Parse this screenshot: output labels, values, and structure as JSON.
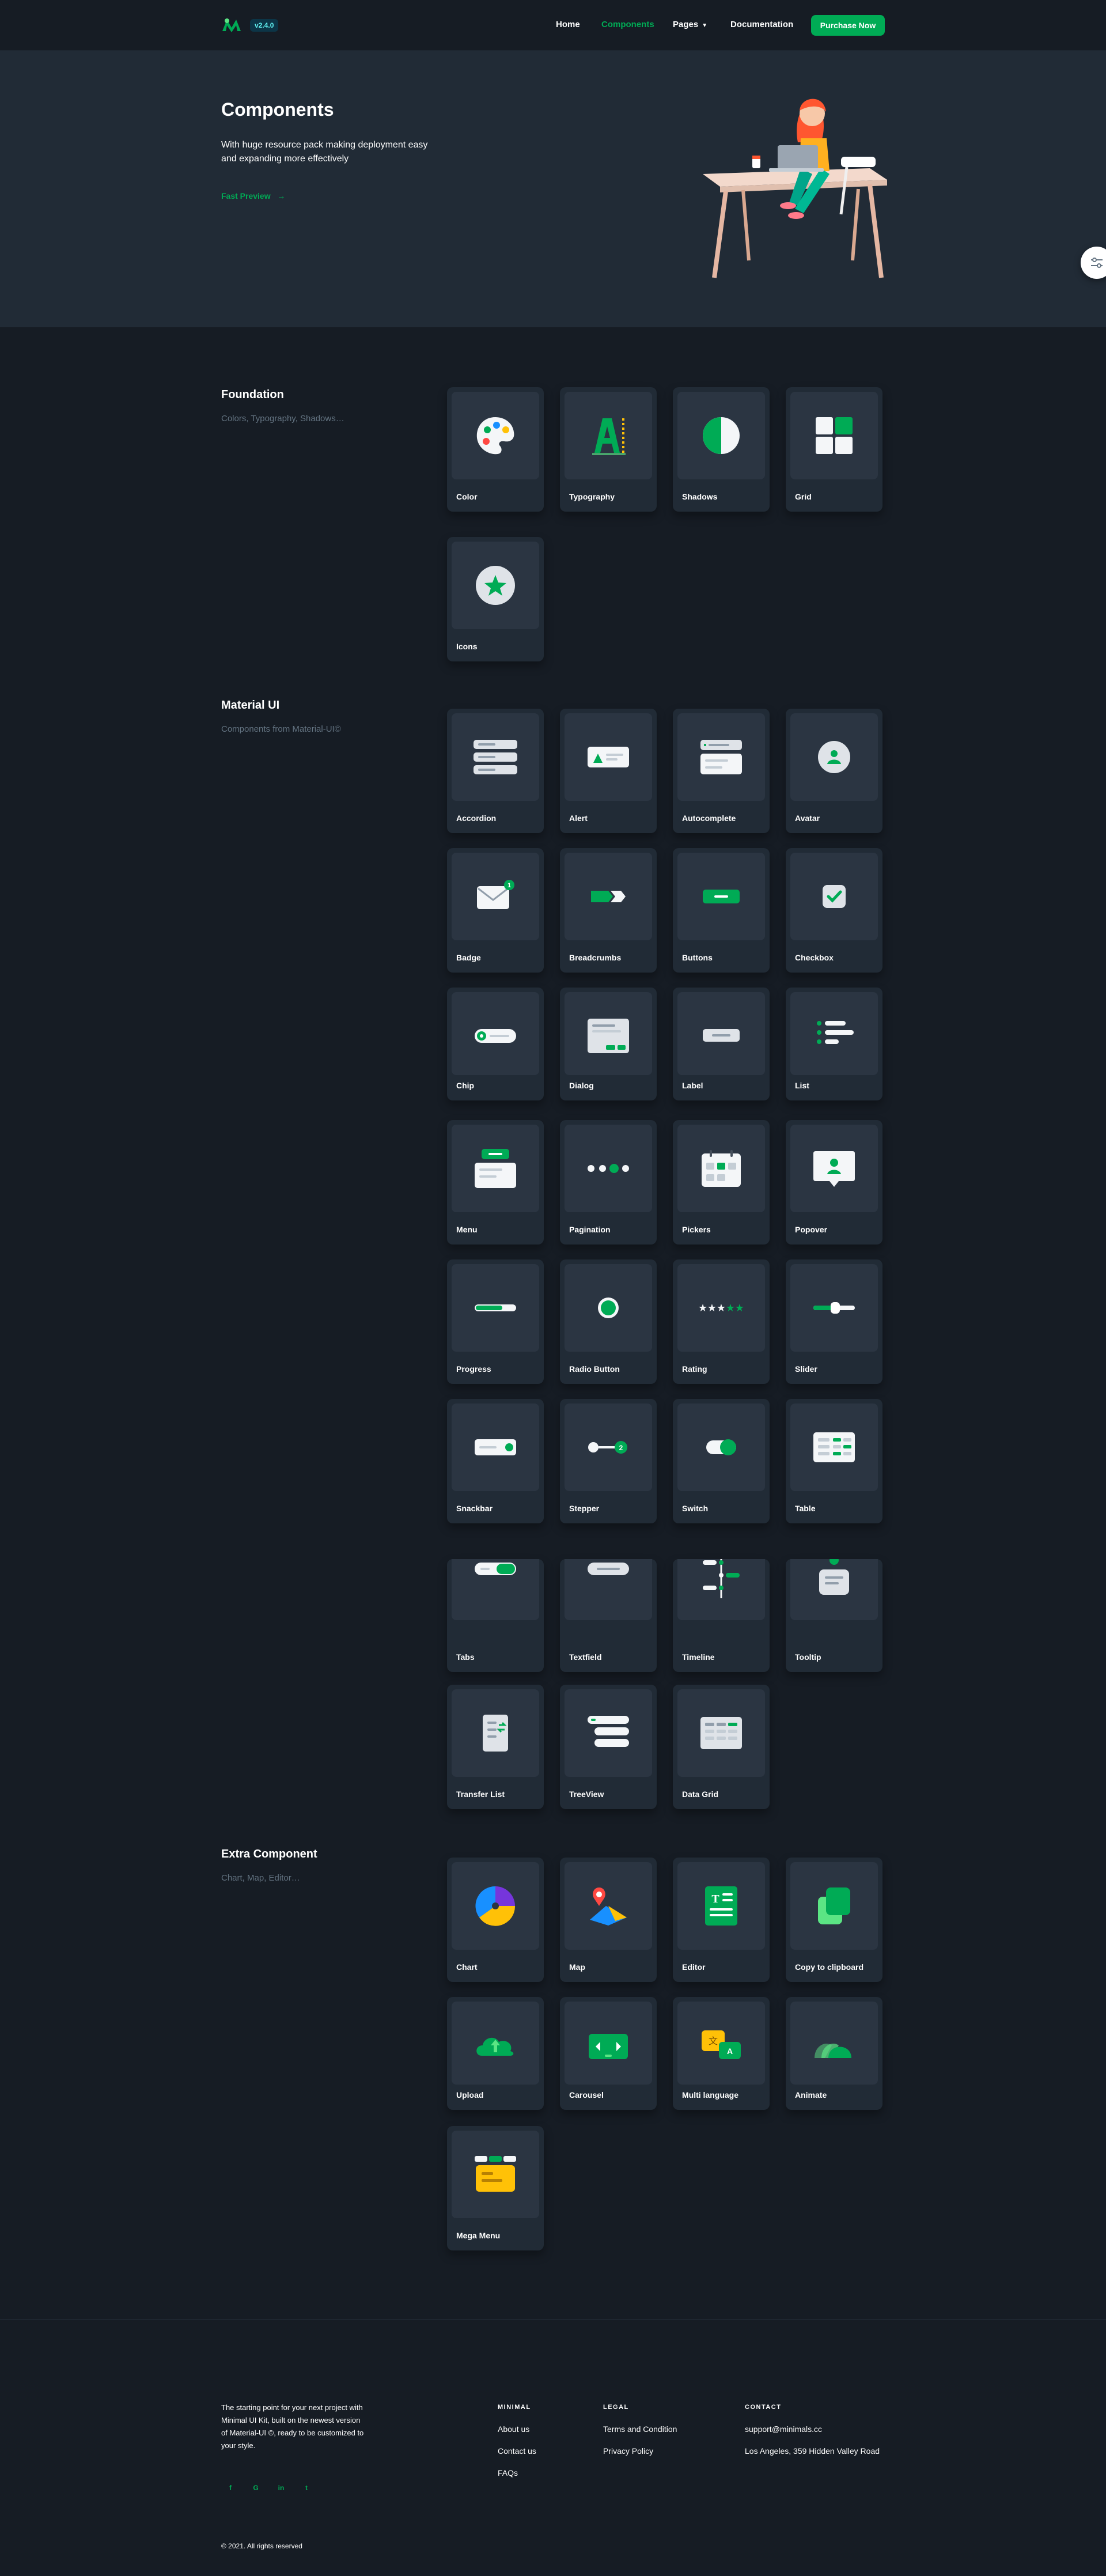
{
  "header": {
    "version": "v2.4.0",
    "nav": {
      "home": "Home",
      "components": "Components",
      "pages": "Pages",
      "documentation": "Documentation"
    },
    "purchase_label": "Purchase Now"
  },
  "hero": {
    "title": "Components",
    "description": "With huge resource pack making deployment easy and expanding more effectively",
    "preview_link": "Fast Preview"
  },
  "sections": {
    "foundation": {
      "title": "Foundation",
      "subtitle": "Colors, Typography, Shadows…",
      "items": [
        "Color",
        "Typography",
        "Shadows",
        "Grid",
        "Icons"
      ]
    },
    "material": {
      "title": "Material UI",
      "subtitle": "Components from Material-UI©",
      "items": [
        "Accordion",
        "Alert",
        "Autocomplete",
        "Avatar",
        "Badge",
        "Breadcrumbs",
        "Buttons",
        "Checkbox",
        "Chip",
        "Dialog",
        "Label",
        "List",
        "Menu",
        "Pagination",
        "Pickers",
        "Popover",
        "Progress",
        "Radio Button",
        "Rating",
        "Slider",
        "Snackbar",
        "Stepper",
        "Switch",
        "Table",
        "Tabs",
        "Textfield",
        "Timeline",
        "Tooltip",
        "Transfer List",
        "TreeView",
        "Data Grid"
      ]
    },
    "extra": {
      "title": "Extra Component",
      "subtitle": "Chart, Map, Editor…",
      "items": [
        "Chart",
        "Map",
        "Editor",
        "Copy to clipboard",
        "Upload",
        "Carousel",
        "Multi language",
        "Animate",
        "Mega Menu"
      ]
    }
  },
  "footer": {
    "description": "The starting point for your next project with Minimal UI Kit, built on the newest version of Material-UI ©, ready to be customized to your style.",
    "social": [
      "f",
      "G",
      "in",
      "t"
    ],
    "columns": {
      "minimal": {
        "heading": "MINIMAL",
        "links": [
          "About us",
          "Contact us",
          "FAQs"
        ]
      },
      "legal": {
        "heading": "LEGAL",
        "links": [
          "Terms and Condition",
          "Privacy Policy"
        ]
      },
      "contact": {
        "heading": "CONTACT",
        "links": [
          "support@minimals.cc",
          "Los Angeles, 359 Hidden Valley Road"
        ]
      }
    },
    "copyright": "© 2021. All rights reserved"
  },
  "colors": {
    "background": "#161c24",
    "paper": "#212b36",
    "primary": "#00ab55",
    "muted": "#637381"
  }
}
